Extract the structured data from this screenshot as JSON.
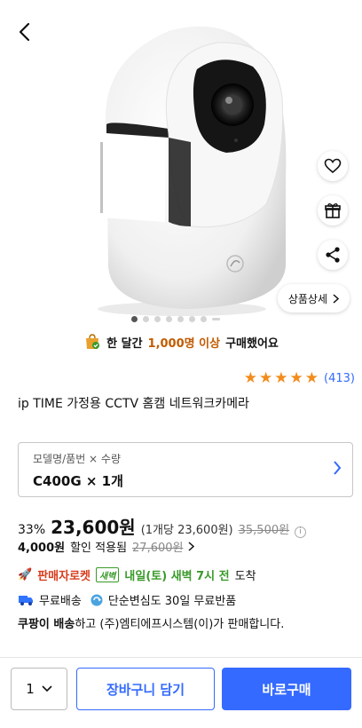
{
  "nav": {
    "back_icon": "chevron-left-icon"
  },
  "actions": {
    "wishlist_icon": "heart-icon",
    "gift_icon": "gift-icon",
    "share_icon": "share-icon",
    "detail_label": "상품상세"
  },
  "carousel": {
    "total": 7,
    "current": 1
  },
  "purchase_banner": {
    "prefix": "한 달간",
    "count": "1,000명 이상",
    "suffix": "구매했어요"
  },
  "rating": {
    "stars": 5,
    "count": "(413)"
  },
  "product": {
    "title": "ip TIME 가정용 CCTV 홈캠 네트워크카메라"
  },
  "option": {
    "label": "모델명/품번 × 수량",
    "value": "C400G × 1개"
  },
  "price": {
    "discount": "33%",
    "sale": "23,600원",
    "unit": "(1개당 23,600원)",
    "original": "35,500원",
    "coupon_amount": "4,000원",
    "coupon_text": "할인 적용됨",
    "coupon_price": "27,600원"
  },
  "delivery": {
    "rocket_label": "판매자로켓",
    "dawn_badge": "새벽",
    "date_text": "내일(토) 새벽 7시 전",
    "arrive": "도착",
    "free_shipping": "무료배송",
    "return_policy": "단순변심도 30일 무료반품",
    "seller_bold": "쿠팡이 배송",
    "seller_rest": "하고 (주)엠티에프시스템(이)가 판매합니다."
  },
  "bottom": {
    "qty": "1",
    "cart": "장바구니 담기",
    "buy": "바로구매"
  },
  "colors": {
    "accent": "#346aff",
    "star": "#f28c1b",
    "green": "#3a9a2a"
  }
}
